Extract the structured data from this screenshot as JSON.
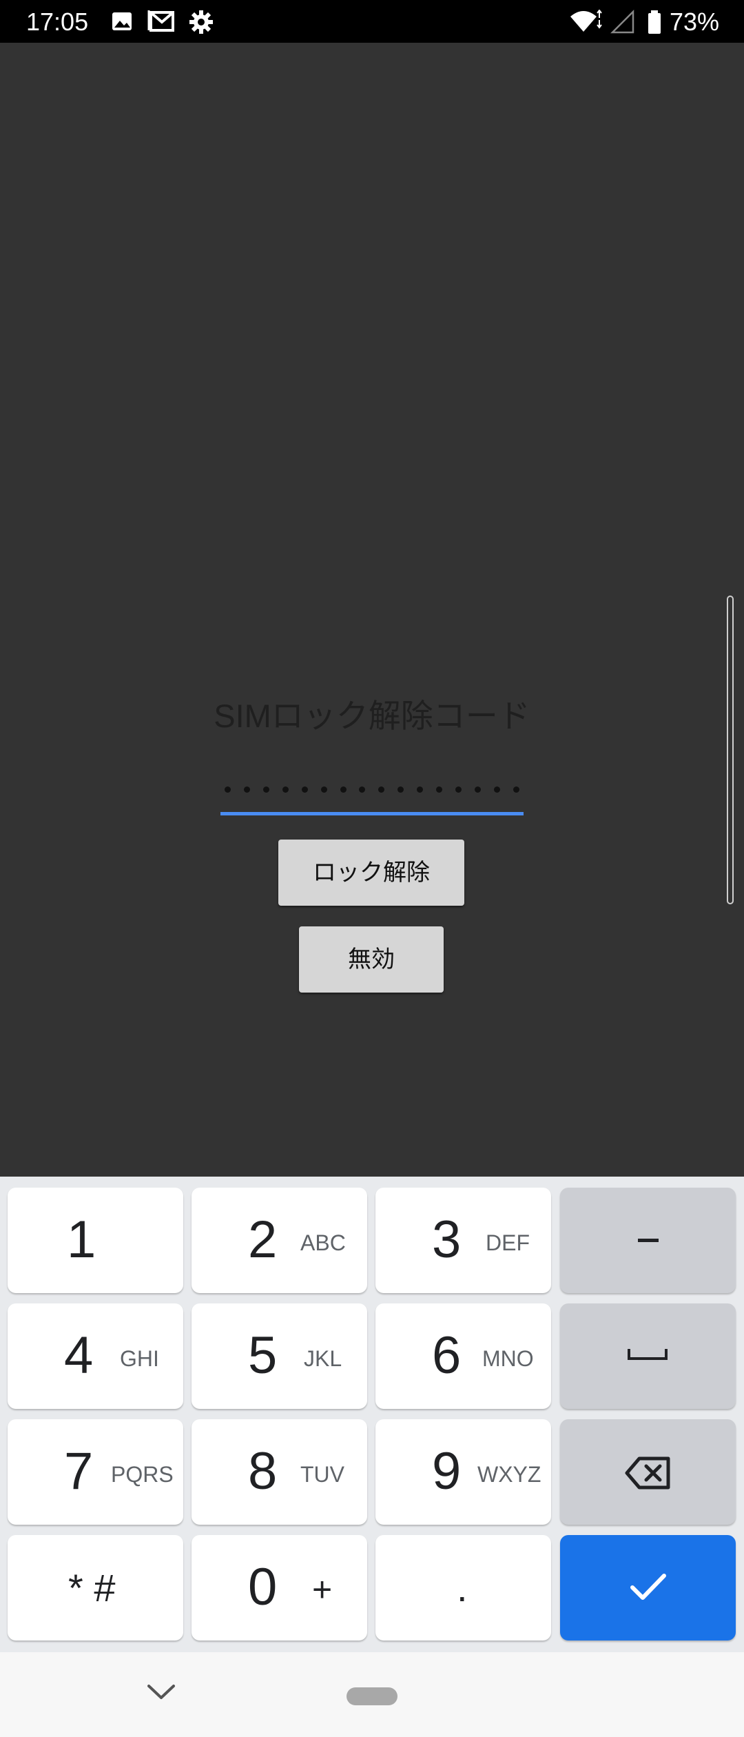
{
  "status_bar": {
    "time": "17:05",
    "battery": "73%",
    "notification_icons": [
      "image-icon",
      "gmail-icon",
      "settings-gear-icon"
    ],
    "system_icons": [
      "wifi-icon",
      "signal-icon",
      "battery-icon"
    ]
  },
  "lock_screen": {
    "title": "SIMロック解除コード",
    "pin_length": 16,
    "unlock_button": "ロック解除",
    "disable_button": "無効"
  },
  "keyboard": {
    "keys": [
      {
        "num": "1",
        "letters": ""
      },
      {
        "num": "2",
        "letters": "ABC"
      },
      {
        "num": "3",
        "letters": "DEF"
      },
      {
        "num": "4",
        "letters": "GHI"
      },
      {
        "num": "5",
        "letters": "JKL"
      },
      {
        "num": "6",
        "letters": "MNO"
      },
      {
        "num": "7",
        "letters": "PQRS"
      },
      {
        "num": "8",
        "letters": "TUV"
      },
      {
        "num": "9",
        "letters": "WXYZ"
      },
      {
        "num": "* #",
        "letters": ""
      },
      {
        "num": "0",
        "letters": "+"
      },
      {
        "num": ".",
        "letters": ""
      }
    ],
    "function_keys": [
      "minus-icon",
      "space-icon",
      "backspace-icon",
      "enter-check-icon"
    ],
    "colors": {
      "accent": "#1a73e8",
      "key": "#ffffff",
      "function_key": "#ccced3"
    }
  },
  "nav_bar": {
    "icons": [
      "collapse-keyboard-icon",
      "home-pill-icon"
    ]
  }
}
